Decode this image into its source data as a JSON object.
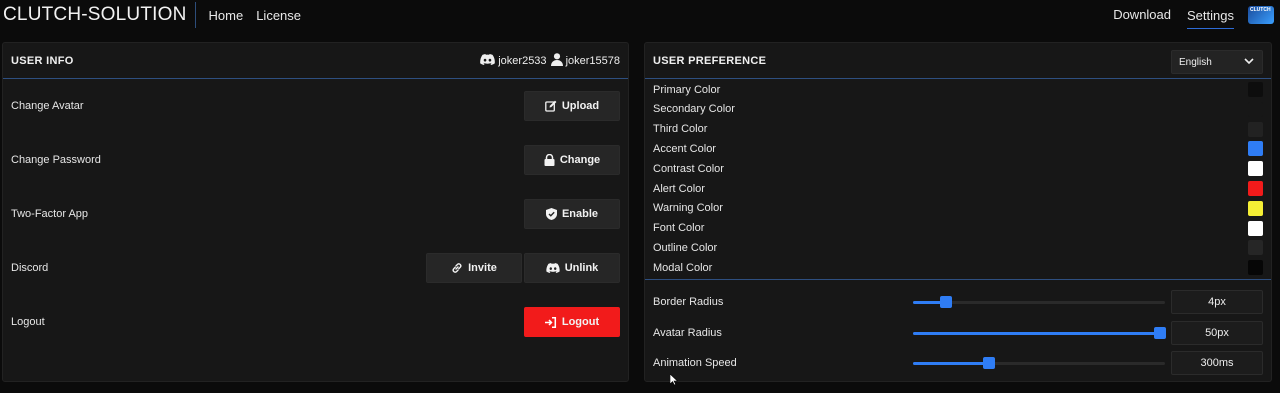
{
  "nav": {
    "brand": "CLUTCH-SOLUTION",
    "left_links": [
      "Home",
      "License"
    ],
    "right_links": [
      "Download",
      "Settings"
    ],
    "active": "Settings",
    "avatar_text": "CLUTCH"
  },
  "user_info": {
    "title": "USER INFO",
    "accounts": [
      {
        "icon": "discord-icon",
        "name": "joker2533"
      },
      {
        "icon": "user-icon",
        "name": "joker15578"
      }
    ],
    "rows": {
      "avatar": {
        "label": "Change Avatar",
        "button": "Upload"
      },
      "password": {
        "label": "Change Password",
        "button": "Change"
      },
      "twofa": {
        "label": "Two-Factor App",
        "button": "Enable"
      },
      "discord": {
        "label": "Discord",
        "button_invite": "Invite",
        "button_unlink": "Unlink"
      },
      "logout": {
        "label": "Logout",
        "button": "Logout"
      }
    },
    "logout_color": "#f21b1b"
  },
  "user_preference": {
    "title": "USER PREFERENCE",
    "language": "English",
    "colors": [
      {
        "label": "Primary Color",
        "value": "#0d0d0d"
      },
      {
        "label": "Secondary Color",
        "value": "#171717"
      },
      {
        "label": "Third Color",
        "value": "#222222"
      },
      {
        "label": "Accent Color",
        "value": "#2f7df5"
      },
      {
        "label": "Contrast Color",
        "value": "#ffffff"
      },
      {
        "label": "Alert Color",
        "value": "#f21b1b"
      },
      {
        "label": "Warning Color",
        "value": "#f5ef35"
      },
      {
        "label": "Font Color",
        "value": "#ffffff"
      },
      {
        "label": "Outline Color",
        "value": "#262626"
      },
      {
        "label": "Modal Color",
        "value": "#060606"
      }
    ],
    "sliders": [
      {
        "label": "Border Radius",
        "value": "4px",
        "fraction": 0.13
      },
      {
        "label": "Avatar Radius",
        "value": "50px",
        "fraction": 0.98
      },
      {
        "label": "Animation Speed",
        "value": "300ms",
        "fraction": 0.3
      }
    ]
  }
}
